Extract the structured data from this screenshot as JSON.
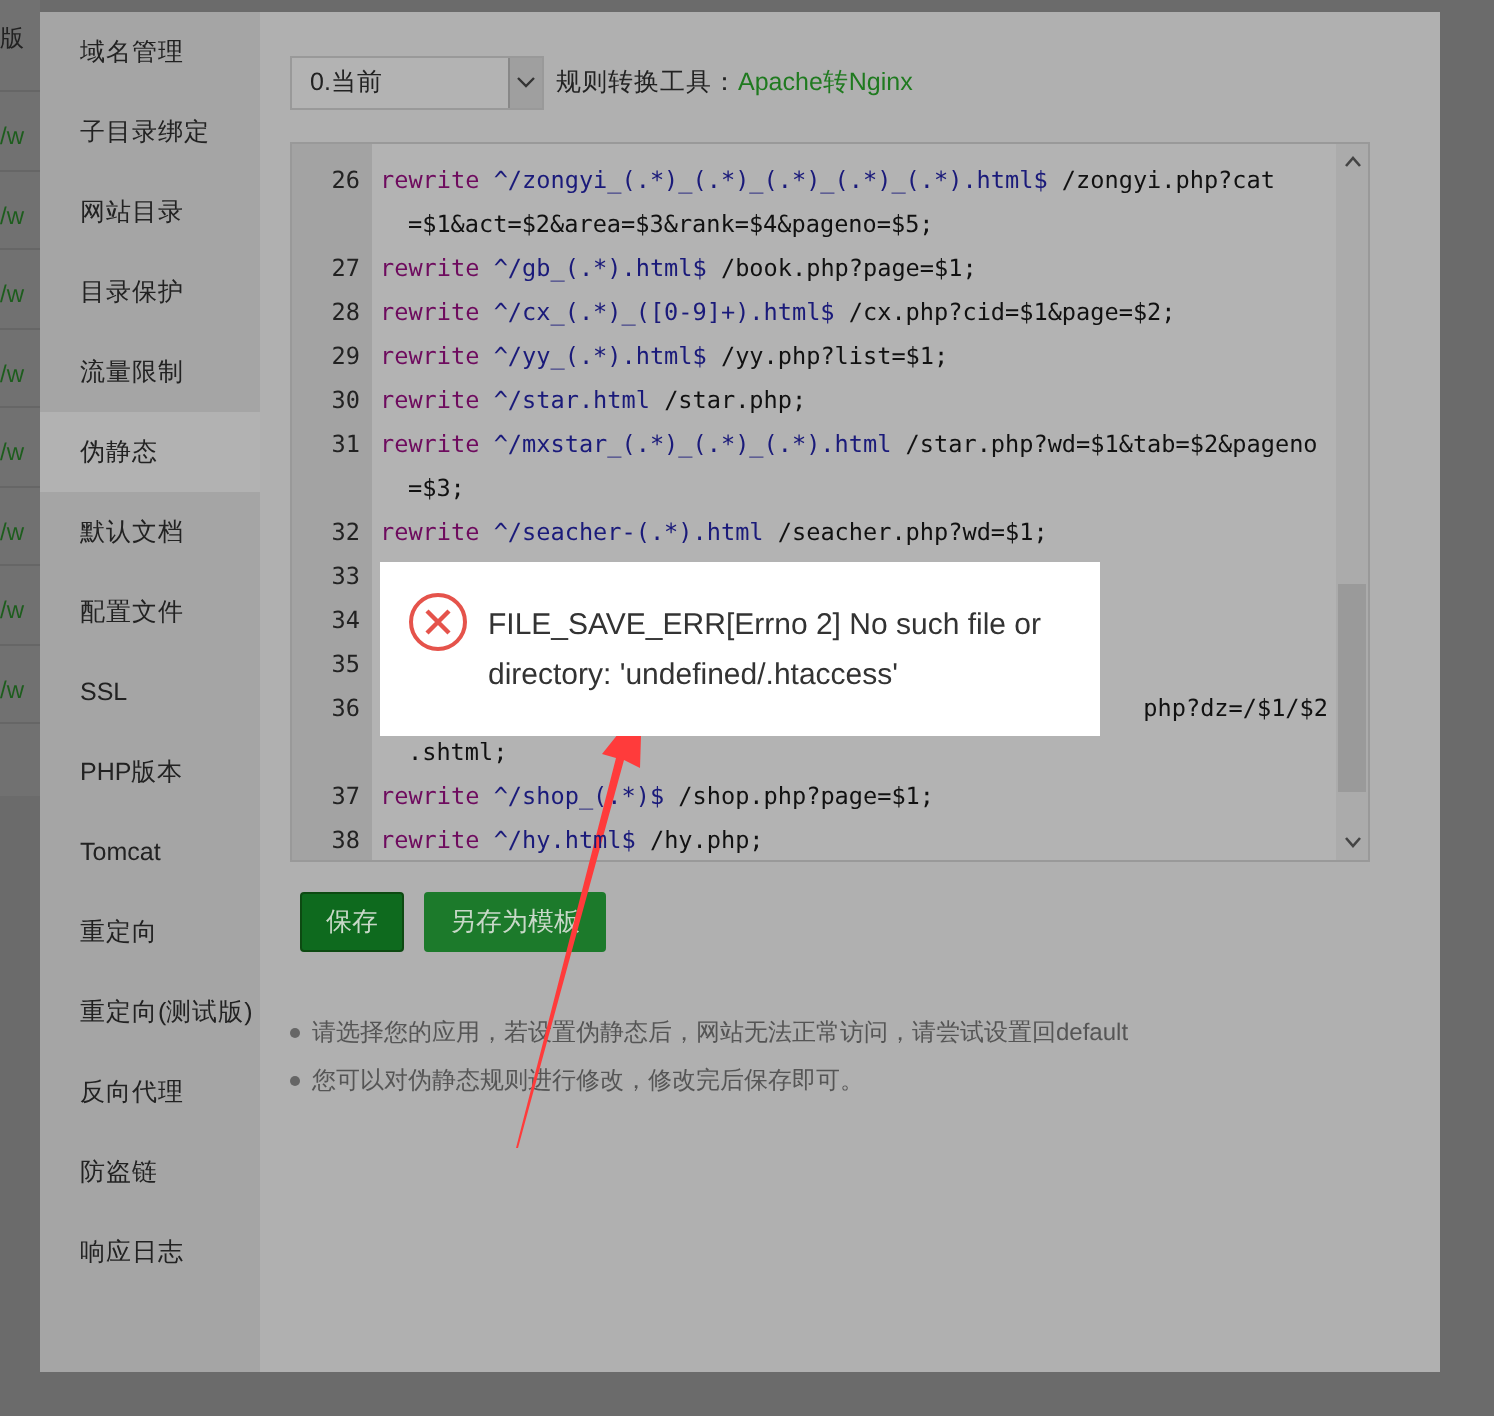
{
  "background_page": {
    "header": "版",
    "links": [
      "/w",
      "/w",
      "/w",
      "/w",
      "/w",
      "/w",
      "/w",
      "/w"
    ]
  },
  "sidebar": {
    "items": [
      {
        "label": "域名管理",
        "selected": false
      },
      {
        "label": "子目录绑定",
        "selected": false
      },
      {
        "label": "网站目录",
        "selected": false
      },
      {
        "label": "目录保护",
        "selected": false
      },
      {
        "label": "流量限制",
        "selected": false
      },
      {
        "label": "伪静态",
        "selected": true
      },
      {
        "label": "默认文档",
        "selected": false
      },
      {
        "label": "配置文件",
        "selected": false
      },
      {
        "label": "SSL",
        "selected": false
      },
      {
        "label": "PHP版本",
        "selected": false
      },
      {
        "label": "Tomcat",
        "selected": false
      },
      {
        "label": "重定向",
        "selected": false
      },
      {
        "label": "重定向(测试版)",
        "selected": false
      },
      {
        "label": "反向代理",
        "selected": false
      },
      {
        "label": "防盗链",
        "selected": false
      },
      {
        "label": "响应日志",
        "selected": false
      }
    ]
  },
  "rule_select": {
    "value": "0.当前"
  },
  "converter": {
    "label": "规则转换工具：",
    "link": "Apache转Nginx"
  },
  "code_lines": [
    {
      "kind": "line",
      "number": "26",
      "keyword": "rewrite",
      "pattern": "^/zongyi_(.*)_(.*)_(.*)_(.*)_(.*).html$",
      "target": "/zongyi.php?cat"
    },
    {
      "kind": "wrap",
      "text": "=$1&act=$2&area=$3&rank=$4&pageno=$5;"
    },
    {
      "kind": "line",
      "number": "27",
      "keyword": "rewrite",
      "pattern": "^/gb_(.*).html$",
      "target": "/book.php?page=$1;"
    },
    {
      "kind": "line",
      "number": "28",
      "keyword": "rewrite",
      "pattern": "^/cx_(.*)_([0-9]+).html$",
      "target": "/cx.php?cid=$1&page=$2;"
    },
    {
      "kind": "line",
      "number": "29",
      "keyword": "rewrite",
      "pattern": "^/yy_(.*).html$",
      "target": "/yy.php?list=$1;"
    },
    {
      "kind": "line",
      "number": "30",
      "keyword": "rewrite",
      "pattern": "^/star.html",
      "target": "/star.php;"
    },
    {
      "kind": "line",
      "number": "31",
      "keyword": "rewrite",
      "pattern": "^/mxstar_(.*)_(.*)_(.*).html",
      "target": "/star.php?wd=$1&tab=$2&pageno"
    },
    {
      "kind": "wrap",
      "text": "=$3;"
    },
    {
      "kind": "line",
      "number": "32",
      "keyword": "rewrite",
      "pattern": "^/seacher-(.*).html",
      "target": "/seacher.php?wd=$1;"
    },
    {
      "kind": "hidden",
      "number": "33"
    },
    {
      "kind": "hidden",
      "number": "34"
    },
    {
      "kind": "hidden",
      "number": "35"
    },
    {
      "kind": "tail",
      "number": "36",
      "text": "php?dz=/$1/$2"
    },
    {
      "kind": "wrap",
      "text": ".shtml;"
    },
    {
      "kind": "line",
      "number": "37",
      "keyword": "rewrite",
      "pattern": "^/shop_(.*)$",
      "target": "/shop.php?page=$1;"
    },
    {
      "kind": "line",
      "number": "38",
      "keyword": "rewrite",
      "pattern": "^/hy.html$",
      "target": "/hy.php;"
    }
  ],
  "buttons": [
    {
      "label": "保存",
      "kind": "primary"
    },
    {
      "label": "另存为模板",
      "kind": "secondary"
    }
  ],
  "tips": [
    "请选择您的应用，若设置伪静态后，网站无法正常访问，请尝试设置回default",
    "您可以对伪静态规则进行修改，修改完后保存即可。"
  ],
  "error_toast": {
    "message": "FILE_SAVE_ERR[Errno 2] No such file or directory: 'undefined/.htaccess'"
  }
}
